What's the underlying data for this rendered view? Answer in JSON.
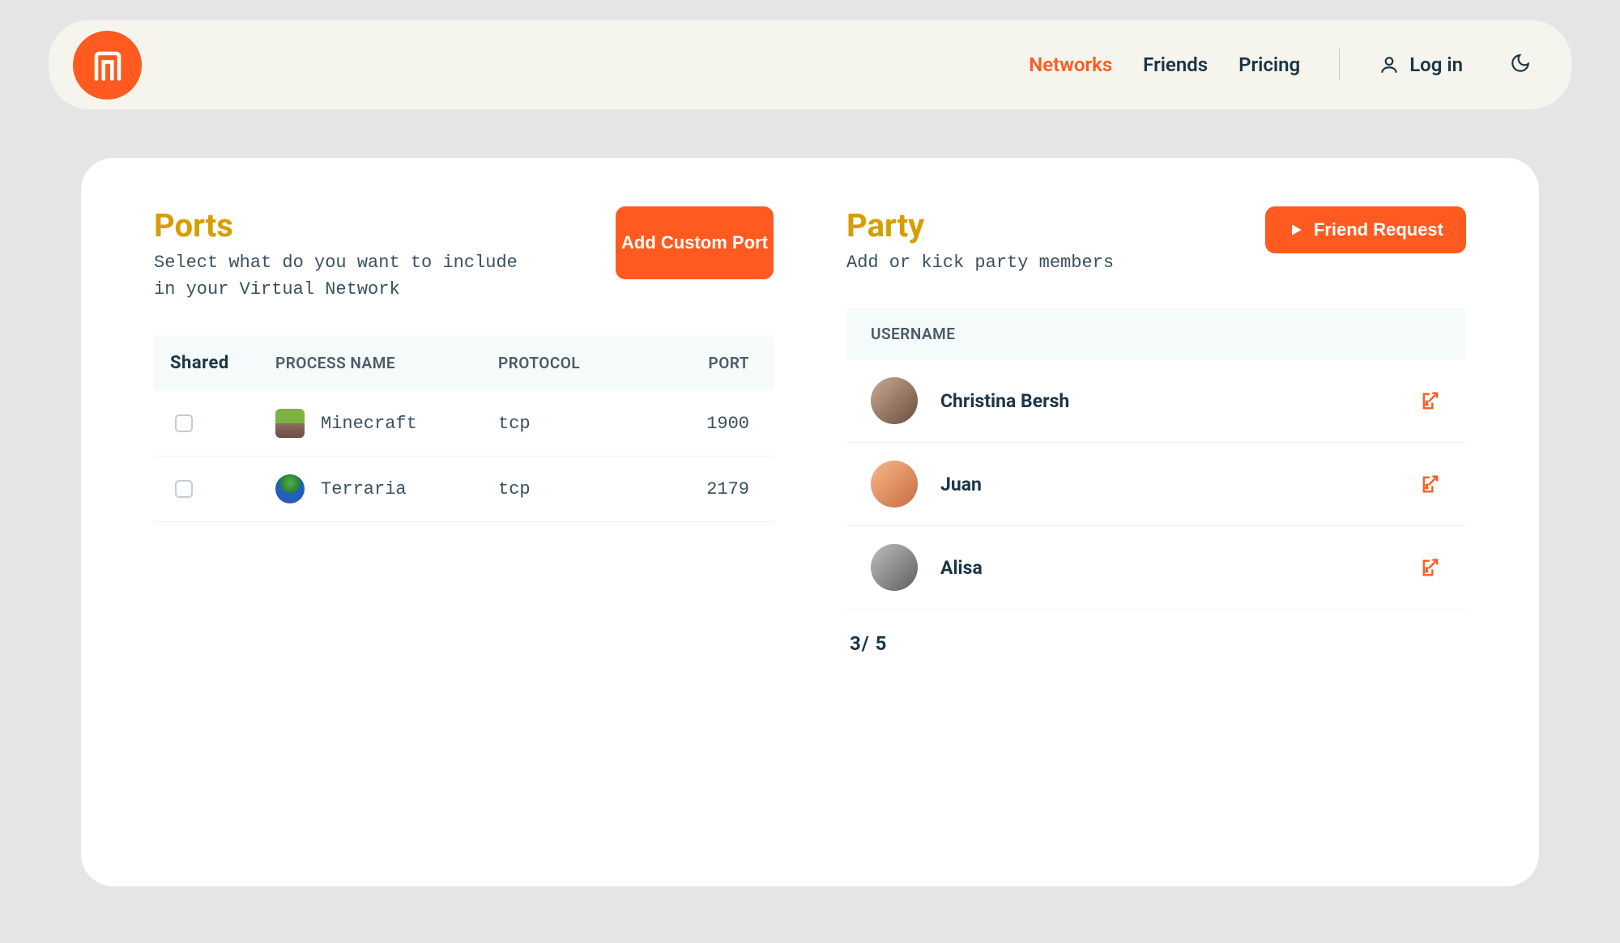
{
  "header": {
    "nav": {
      "networks": "Networks",
      "friends": "Friends",
      "pricing": "Pricing"
    },
    "login": "Log in"
  },
  "ports": {
    "title": "Ports",
    "subtitle": "Select what do you want to include in your Virtual Network",
    "add_button": "Add Custom Port",
    "columns": {
      "shared": "Shared",
      "process": "PROCESS NAME",
      "protocol": "PROTOCOL",
      "port": "PORT"
    },
    "rows": [
      {
        "process": "Minecraft",
        "protocol": "tcp",
        "port": "1900"
      },
      {
        "process": "Terraria",
        "protocol": "tcp",
        "port": "2179"
      }
    ]
  },
  "party": {
    "title": "Party",
    "subtitle": "Add or kick party members",
    "friend_button": "Friend Request",
    "columns": {
      "username": "USERNAME"
    },
    "members": [
      {
        "name": "Christina Bersh"
      },
      {
        "name": "Juan"
      },
      {
        "name": "Alisa"
      }
    ],
    "count": "3/ 5"
  }
}
